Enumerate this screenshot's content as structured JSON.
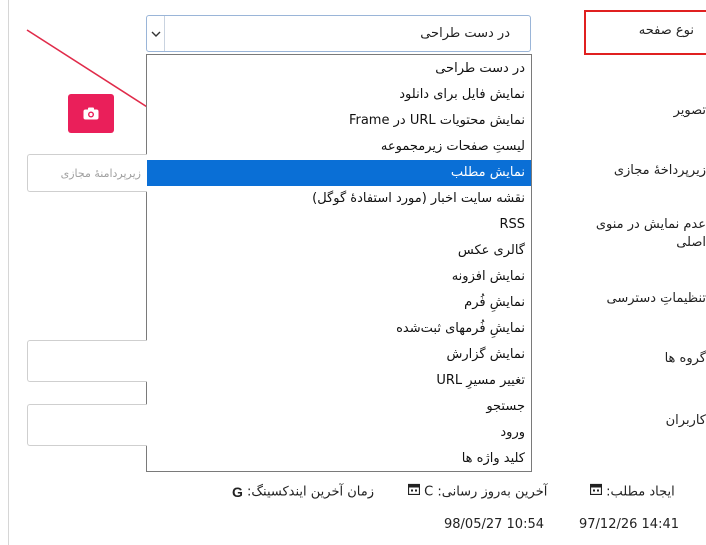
{
  "form": {
    "page_type_label": "نوع صفحه",
    "image_label": "تصویر",
    "virtual_path_label": "زیرپرداخهٔ مجازی",
    "hide_in_menu_label_1": "عدم نمایش در منوی",
    "hide_in_menu_label_2": "اصلی",
    "access_settings_label": "تنظیماتِ دسترسی",
    "groups_label": "گروه ها",
    "users_label": "کاربران",
    "virtual_path_placeholder": "زیرپردامنهٔ مجازی"
  },
  "select": {
    "value": "در دست طراحی"
  },
  "dropdown": {
    "selected_index": 4,
    "options": [
      "در دست طراحی",
      "نمایش فایل برای دانلود",
      "نمایش محتویات URL در Frame",
      "لیستِ صفحات زیرمجموعه",
      "نمایش مطلب",
      "نقشه سایت اخبار (مورد استفادهٔ گوگل)",
      "RSS",
      "گالری عکس",
      "نمایش افزونه",
      "نمایشِ فُرم",
      "نمایشِ فُرمهای ثبت‌شده",
      "نمایش گزارش",
      "تغییر مسیرِ URL",
      "جستجو",
      "ورود",
      "کلید واژه ها"
    ]
  },
  "meta": {
    "created_label": "ایجاد مطلب:",
    "created_value": "14:41 97/12/26",
    "updated_label": "آخرین به‌روز رسانی:",
    "updated_prefix": "C",
    "updated_value": "10:54 98/05/27",
    "indexing_label": "زمان آخرین ایندکسینگ:"
  },
  "colors": {
    "accent": "#0a6fd6",
    "camera_button": "#ea1f5a",
    "highlight_border": "#e02020"
  },
  "icons": {
    "select_toggle": "chevron-down-icon",
    "camera": "camera-icon",
    "calendar": "calendar-icon",
    "google": "google-icon"
  }
}
